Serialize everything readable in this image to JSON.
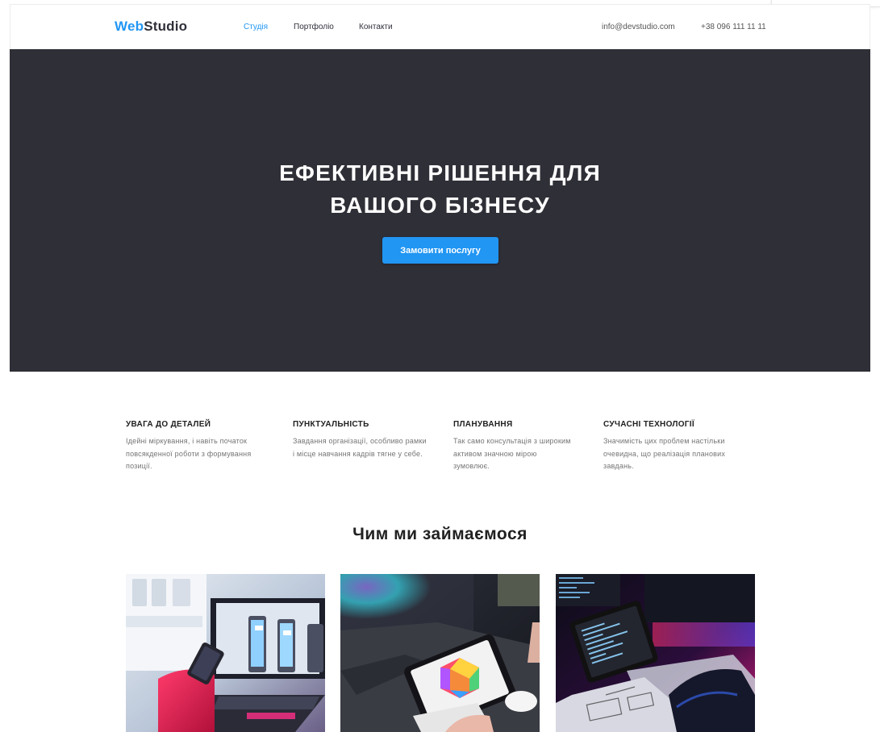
{
  "header": {
    "logo": {
      "prefix": "Web",
      "suffix": "Studio"
    },
    "nav": [
      {
        "label": "Студія",
        "active": true
      },
      {
        "label": "Портфоліо",
        "active": false
      },
      {
        "label": "Контакти",
        "active": false
      }
    ],
    "email": "info@devstudio.com",
    "phone": "+38 096 111 11 11"
  },
  "hero": {
    "title_line1": "ЕФЕКТИВНІ РІШЕННЯ ДЛЯ",
    "title_line2": "ВАШОГО БІЗНЕСУ",
    "cta_label": "Замовити послугу",
    "background": "#2f2f37",
    "accent": "#2196f3"
  },
  "features": [
    {
      "title": "УВАГА ДО ДЕТАЛЕЙ",
      "lines": [
        "Ідейні міркування, і навіть початок",
        "повсякденної роботи з формування",
        "позиції."
      ]
    },
    {
      "title": "ПУНКТУАЛЬНІСТЬ",
      "lines": [
        "Завдання організації, особливо рамки",
        "і місце навчання кадрів тягне у себе."
      ]
    },
    {
      "title": "ПЛАНУВАННЯ",
      "lines": [
        "Так само консультація з широким",
        "активом значною мірою",
        "зумовлює."
      ]
    },
    {
      "title": "СУЧАСНІ ТЕХНОЛОГІЇ",
      "lines": [
        "Значимість цих проблем настільки",
        "очевидна, що реалізація планових",
        "завдань."
      ]
    }
  ],
  "services": {
    "title": "Чим ми займаємося",
    "cards": [
      {
        "image": "phone-ui-design-photo"
      },
      {
        "image": "tablet-color-palette-photo"
      },
      {
        "image": "code-laptop-neon-photo"
      }
    ]
  }
}
